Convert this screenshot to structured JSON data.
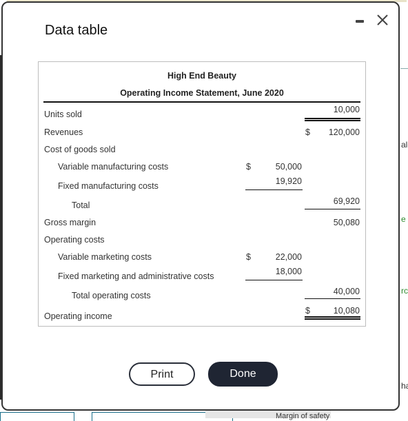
{
  "background": {
    "right_fragments": [
      "alc",
      "e c",
      "rce",
      "har"
    ],
    "bottom_fragment": "Margin of safety"
  },
  "dialog": {
    "title": "Data table",
    "minimize_icon": "minimize-icon",
    "close_icon": "close-icon",
    "statement": {
      "company": "High End Beauty",
      "title": "Operating Income Statement, June 2020",
      "rows": {
        "units_sold": {
          "label": "Units sold",
          "total": "10,000"
        },
        "revenues": {
          "label": "Revenues",
          "currency": "$",
          "total": "120,000"
        },
        "cogs": {
          "label": "Cost of goods sold"
        },
        "var_mfg": {
          "label": "Variable manufacturing costs",
          "currency": "$",
          "amount": "50,000"
        },
        "fixed_mfg": {
          "label": "Fixed manufacturing costs",
          "amount": "19,920"
        },
        "cogs_total": {
          "label": "Total",
          "total": "69,920"
        },
        "gross_margin": {
          "label": "Gross margin",
          "total": "50,080"
        },
        "op_costs": {
          "label": "Operating costs"
        },
        "var_mkt": {
          "label": "Variable marketing costs",
          "currency": "$",
          "amount": "22,000"
        },
        "fixed_mkt_admin": {
          "label": "Fixed marketing and administrative costs",
          "amount": "18,000"
        },
        "total_op": {
          "label": "Total operating costs",
          "total": "40,000"
        },
        "op_income": {
          "label": "Operating income",
          "currency": "$",
          "total": "10,080"
        }
      }
    },
    "buttons": {
      "print": "Print",
      "done": "Done"
    }
  }
}
